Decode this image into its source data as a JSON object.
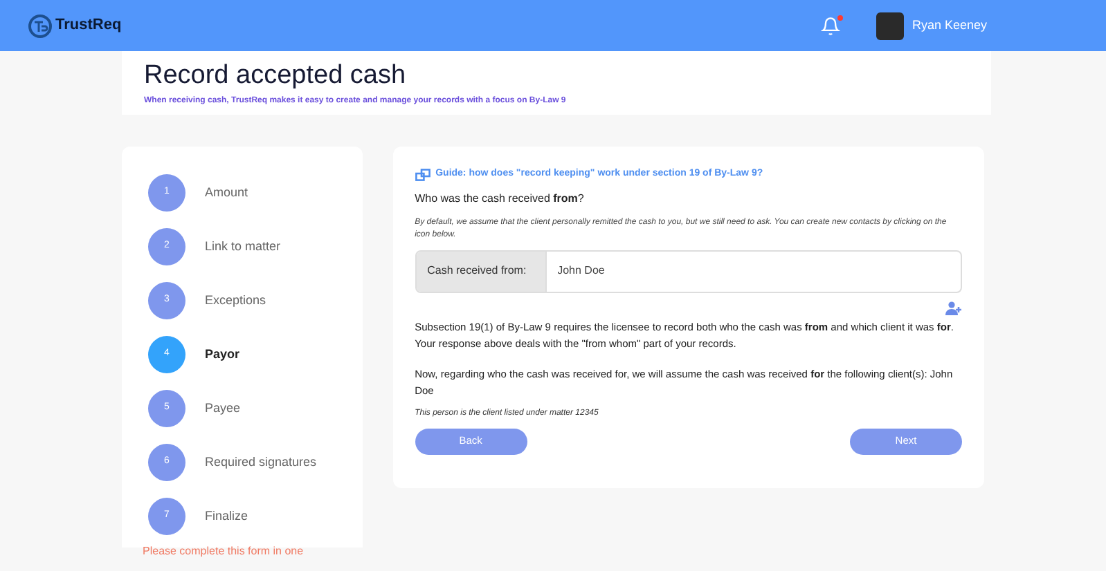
{
  "header": {
    "logo_text": "TrustReq",
    "user_name": "Ryan Keeney",
    "has_notification": true
  },
  "page": {
    "title": "Record accepted cash",
    "subtitle": "When receiving cash, TrustReq makes it easy to create and manage your records with a focus on By-Law 9"
  },
  "steps": [
    {
      "number": "1",
      "label": "Amount",
      "selected": false
    },
    {
      "number": "2",
      "label": "Link to matter",
      "selected": false
    },
    {
      "number": "3",
      "label": "Exceptions",
      "selected": false
    },
    {
      "number": "4",
      "label": "Payor",
      "selected": true
    },
    {
      "number": "5",
      "label": "Payee",
      "selected": false
    },
    {
      "number": "6",
      "label": "Required signatures",
      "selected": false
    },
    {
      "number": "7",
      "label": "Finalize",
      "selected": false
    }
  ],
  "sidebar_note": "Please complete this form in one",
  "form": {
    "guide_link": "Guide: how does \"record keeping\" work under section 19 of By-Law 9?",
    "question": "Who was the cash received **from**?",
    "hint": "By default, we assume that the client personally remitted the cash to you, but we still need to ask. You can create new contacts by clicking on the icon below.",
    "field_label": "Cash received from:",
    "field_value": "John Doe",
    "paragraph_1": "Subsection 19(1) of By-Law 9 requires the licensee to record both who the cash was **from** and which client it was **for**. Your response above deals with the \"from whom\" part of your records.",
    "paragraph_2": "Now, regarding who the cash was received for, we will assume the cash was received **for** the following client(s): John Doe",
    "note": "This person is the client listed under matter 12345",
    "buttons": [
      "Back",
      "Next"
    ]
  }
}
